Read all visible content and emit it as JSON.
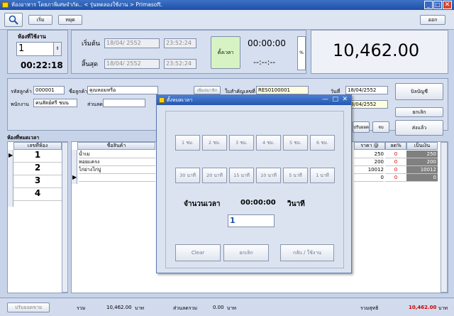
{
  "window": {
    "title": "ห้องอาหาร โดยภาพิเศษจำกัด.. < รุ่นทดลองใช้งาน > Primasoft.",
    "minimize": "_",
    "restore": "□",
    "close": "✕"
  },
  "toolbar": {
    "search_icon": "magnifier-icon",
    "btn_start": "เริ่ม",
    "btn_pause": "หยุด",
    "btn_exit": "ออก"
  },
  "room_panel": {
    "label": "ห้องที่ใช้งาน",
    "room_value": "1",
    "elapsed": "00:22:18"
  },
  "time_panel": {
    "start_label": "เริ่มต้น",
    "end_label": "สิ้นสุด",
    "start_date": "18/04/ 2552",
    "start_time": "23:52:24",
    "end_date": "18/04/ 2552",
    "end_time": "23:52:24",
    "set_time_button": "ตั้งเวลา",
    "timer": "00:00:00",
    "timer_sub": "--:--:--",
    "percent_label": "%"
  },
  "total_display": "10,462.00",
  "customer": {
    "code_label": "รหัสลูกค้า",
    "code_value": "000001",
    "name_label": "ชื่อลูกค้า",
    "name_value": "คุณหอมหรือ",
    "member_button": "เพิ่มสมาชิก",
    "invoice_label": "ใบสำคัญเลขที่",
    "invoice_value": "RES0100001",
    "date_label": "วันที่",
    "date_value": "18/04/2552",
    "date_value2": "18/04/2552",
    "staff_label": "พนักงาน",
    "staff_value": "คนสัตย์ศรี ชมน",
    "discount_label": "ส่วนลด"
  },
  "side_buttons": {
    "accounts": "บิลบัญชี",
    "cancel": "ยกเลิก",
    "send": "ส่งแล้ว",
    "small_a": "ปรับยอด",
    "small_b": "จบ"
  },
  "rooms_table": {
    "title": "ห้องที่หมดเวลา",
    "header": "เลขที่ห้อง",
    "rows": [
      "1",
      "2",
      "3",
      "4"
    ]
  },
  "items_table": {
    "header_name": "ชื่อสินค้า",
    "header_price": "ราคา @",
    "header_disc": "ลด%",
    "header_total": "เป็นเงิน",
    "rows": [
      {
        "name": "น้ำเม",
        "price": "250",
        "disc": "0",
        "total": "250"
      },
      {
        "name": "หอยแครง",
        "price": "200",
        "disc": "0",
        "total": "200"
      },
      {
        "name": "ไก่ย่างไก่ปู",
        "price": "10012",
        "disc": "0",
        "total": "10012"
      },
      {
        "name": "",
        "price": "0",
        "disc": "0",
        "total": "0"
      }
    ]
  },
  "dialog": {
    "title": "ตั้งหมดเวลา",
    "hour_buttons": [
      "1 ชม.",
      "2 ชม.",
      "3 ชม.",
      "4 ชม.",
      "5 ชม.",
      "6 ชม."
    ],
    "minute_buttons": [
      "30 นาที",
      "20 นาที",
      "15 นาที",
      "10 นาที",
      "5 นาที",
      "1 นาที"
    ],
    "amount_label": "จำนวนเวลา",
    "amount_value": "00:00:00",
    "unit_label": "วินาที",
    "input_value": "1",
    "clear_button": "Clear",
    "cancel_button": "ยกเลิก",
    "ok_button": "กลับ / ใช้งาน"
  },
  "status": {
    "btn_left": "ปรับยอดขาย",
    "sum_label": "รวม",
    "sum_value": "10,462.00",
    "sum_unit": "บาท",
    "discount_label": "ส่วนลดรวม",
    "discount_value": "0.00",
    "discount_unit": "บาท",
    "net_label": "รวมสุทธิ",
    "net_value": "10,462.00",
    "net_unit": "บาท"
  },
  "colors": {
    "title_blue": "#1e4fa8",
    "price_red": "#cc0000",
    "total_bg": "#808080"
  }
}
